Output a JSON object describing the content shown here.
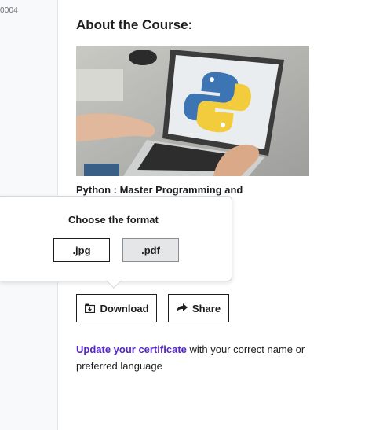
{
  "sidebar": {
    "id_fragment": "0004"
  },
  "main": {
    "title": "About the Course:",
    "course_name": "Python : Master Programming and",
    "download_label": "Download",
    "share_label": "Share",
    "update_link": "Update your certificate",
    "update_rest": " with your correct name or preferred language"
  },
  "popover": {
    "title": "Choose the format",
    "formats": [
      ".jpg",
      ".pdf"
    ],
    "selected": ".pdf"
  },
  "icons": {
    "download": "download-icon",
    "share": "share-arrow-icon",
    "course_image": "python-logo-laptop-image"
  },
  "colors": {
    "link": "#5624d0",
    "selected_bg": "#e4e6e8"
  }
}
